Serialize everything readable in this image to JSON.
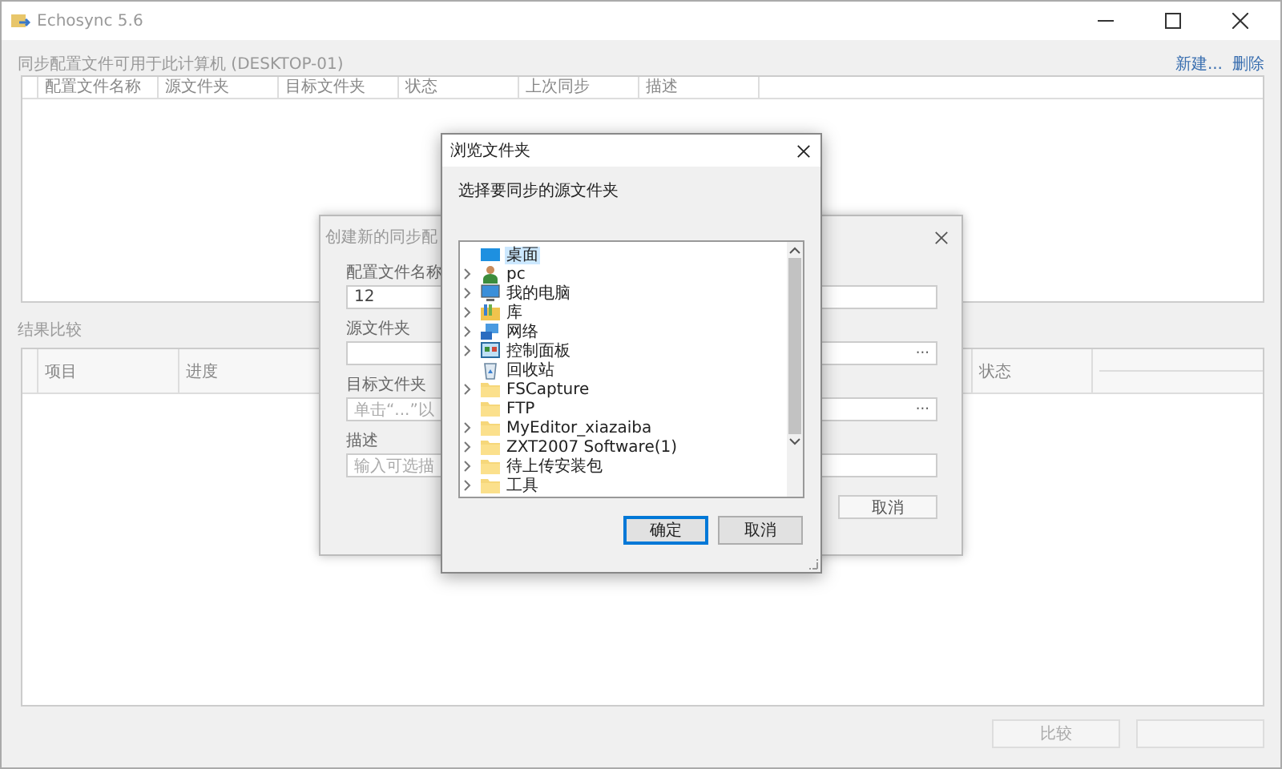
{
  "window": {
    "title": "Echosync 5.6"
  },
  "profiles": {
    "label": "同步配置文件可用于此计算机 (DESKTOP-01)",
    "links": [
      "新建...",
      "删除"
    ],
    "columns": [
      "配置文件名称",
      "源文件夹",
      "目标文件夹",
      "状态",
      "上次同步",
      "描述"
    ]
  },
  "results": {
    "label": "结果比较",
    "columns": [
      "项目",
      "进度",
      "状态"
    ]
  },
  "buttons": [
    {
      "label": "比较",
      "disabled": true
    },
    {
      "disabled": true
    }
  ],
  "create_dialog": {
    "title": "创建新的同步配",
    "fields": [
      {
        "label": "配置文件名称",
        "value": "12"
      },
      {
        "label": "源文件夹",
        "browse": "···"
      },
      {
        "label": "目标文件夹",
        "placeholder": "单击“...”以",
        "browse": "···"
      },
      {
        "label": "描述",
        "placeholder": "输入可选描"
      }
    ],
    "buttons": [
      "取消"
    ]
  },
  "browse_dialog": {
    "title": "浏览文件夹",
    "prompt": "选择要同步的源文件夹",
    "tree": [
      {
        "label": "桌面",
        "kind": "desktop",
        "selected": true,
        "children": [
          {
            "label": "pc",
            "kind": "user",
            "selected": false,
            "expandable": true
          },
          {
            "label": "我的电脑",
            "kind": "computer",
            "selected": false,
            "expandable": true
          },
          {
            "label": "库",
            "kind": "library",
            "selected": false,
            "expandable": true
          },
          {
            "label": "网络",
            "kind": "network",
            "selected": false,
            "expandable": true
          },
          {
            "label": "控制面板",
            "kind": "control",
            "selected": false,
            "expandable": true
          },
          {
            "label": "回收站",
            "kind": "recycle",
            "selected": false,
            "expandable": false
          },
          {
            "label": "FSCapture",
            "kind": "folder",
            "selected": false,
            "expandable": true
          },
          {
            "label": "FTP",
            "kind": "folder",
            "selected": false,
            "expandable": false
          },
          {
            "label": "MyEditor_xiazaiba",
            "kind": "folder",
            "selected": false,
            "expandable": true
          },
          {
            "label": "ZXT2007 Software(1)",
            "kind": "folder",
            "selected": false,
            "expandable": true
          },
          {
            "label": "待上传安装包",
            "kind": "folder",
            "selected": false,
            "expandable": true
          },
          {
            "label": "工具",
            "kind": "folder",
            "selected": false,
            "expandable": true
          }
        ]
      }
    ],
    "buttons": [
      {
        "label": "确定",
        "default": true
      },
      {
        "label": "取消",
        "default": false
      }
    ]
  }
}
